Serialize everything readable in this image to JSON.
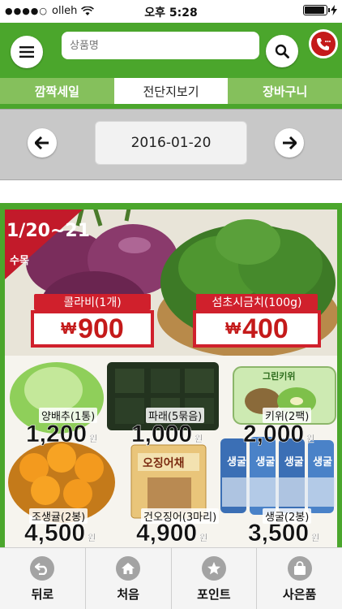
{
  "status_bar": {
    "carrier": "olleh",
    "time": "오후 5:28"
  },
  "header": {
    "search_placeholder": "상품명",
    "icons": [
      "menu-icon",
      "search-icon",
      "phone-icon"
    ]
  },
  "tabs": [
    {
      "label": "깜짝세일",
      "active": false
    },
    {
      "label": "전단지보기",
      "active": true
    },
    {
      "label": "장바구니",
      "active": false
    }
  ],
  "date_nav": {
    "date": "2016-01-20"
  },
  "flyer": {
    "badge_date": "1/20~21",
    "badge_days": "수목",
    "featured": [
      {
        "name": "콜라비(1개)",
        "currency": "₩",
        "price": "900"
      },
      {
        "name": "섬초시금치(100g)",
        "currency": "₩",
        "price": "400"
      }
    ],
    "items": [
      {
        "name": "양배추(1통)",
        "price": "1,200",
        "unit": "원"
      },
      {
        "name": "파래(5묶음)",
        "price": "1,000",
        "unit": "원"
      },
      {
        "name": "키위(2팩)",
        "price": "2,000",
        "unit": "원"
      },
      {
        "name": "조생귤(2봉)",
        "price": "4,500",
        "unit": "원"
      },
      {
        "name": "건오징어(3마리)",
        "price": "4,900",
        "unit": "원"
      },
      {
        "name": "생굴(2봉)",
        "price": "3,500",
        "unit": "원"
      }
    ],
    "package_text": {
      "kiwi_box": "그린키위",
      "squid_pack": "오징어채",
      "oyster_pack": "생굴"
    }
  },
  "bottom_nav": [
    {
      "label": "뒤로",
      "icon": "back-arrow-icon"
    },
    {
      "label": "처음",
      "icon": "home-icon"
    },
    {
      "label": "포인트",
      "icon": "star-icon"
    },
    {
      "label": "사은품",
      "icon": "shopping-bag-icon"
    }
  ],
  "colors": {
    "brand_green": "#4ba62c",
    "tab_inactive": "#85c05c",
    "price_red": "#d0202c"
  }
}
